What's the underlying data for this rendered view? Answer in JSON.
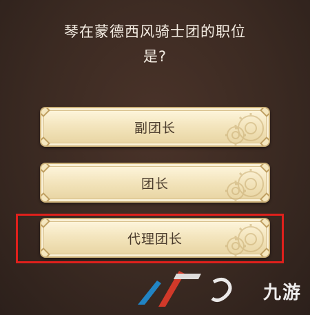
{
  "question": {
    "line1": "琴在蒙德西风骑士团的职位",
    "line2": "是?"
  },
  "options": [
    {
      "label": "副团长"
    },
    {
      "label": "团长"
    },
    {
      "label": "代理团长"
    }
  ],
  "highlighted_option_index": 2,
  "watermark": {
    "text": "九游"
  },
  "colors": {
    "background": "#3b2a22",
    "question_text": "#f4ede3",
    "option_text": "#4a3b2c",
    "option_fill": "#f4e6bf",
    "highlight": "#e0201c"
  }
}
